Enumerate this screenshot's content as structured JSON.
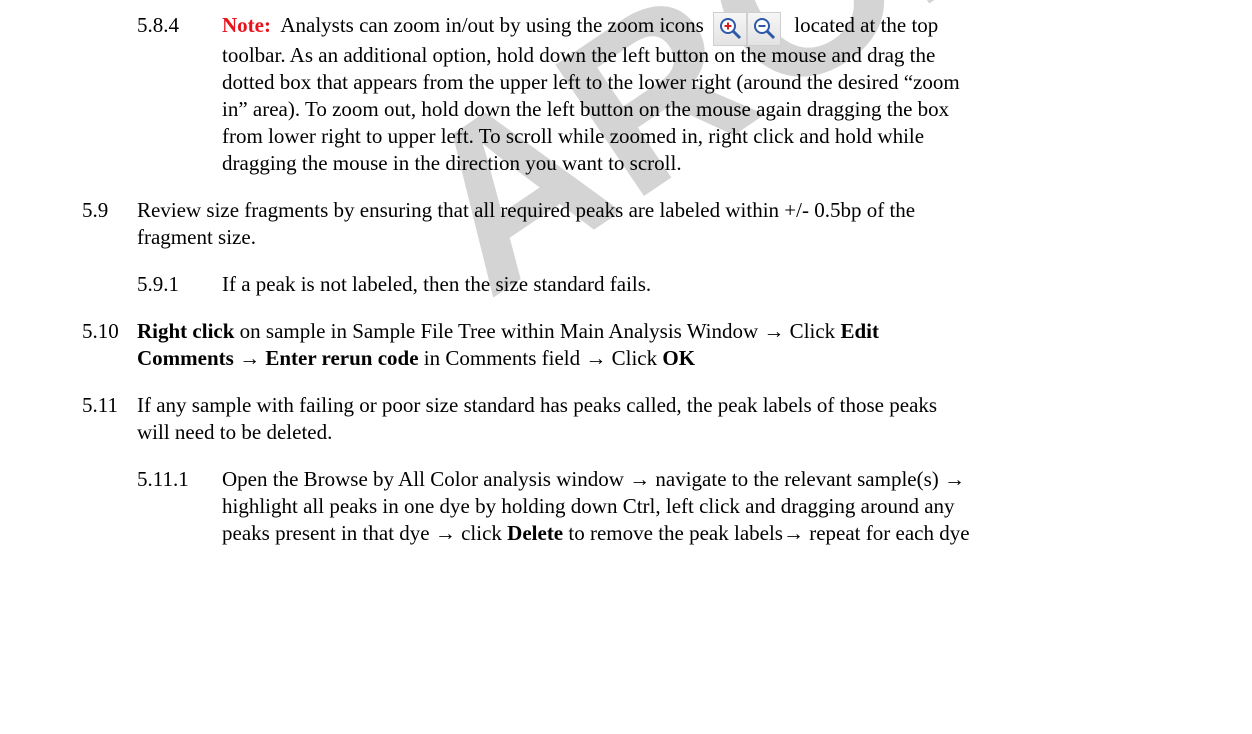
{
  "watermark": "ARCHIVED",
  "s584": {
    "number": "5.8.4",
    "note_label": "Note:",
    "text_before_icons": "Analysts can zoom in/out by using the zoom icons",
    "text_after_icons": "located at the top",
    "lines": [
      "toolbar.  As an additional option, hold down the left button on the mouse and drag the",
      "dotted box that appears from the upper left to the lower right (around the desired “zoom",
      "in” area). To zoom out, hold down the left button on the mouse again dragging the box",
      "from lower right to upper left. To scroll while zoomed in, right click and hold while",
      "dragging the mouse in the direction you want to scroll."
    ]
  },
  "s59": {
    "number": "5.9",
    "lines": [
      "Review size fragments by ensuring that all required peaks are labeled within +/- 0.5bp of the",
      "fragment size."
    ]
  },
  "s591": {
    "number": "5.9.1",
    "text": "If a peak is not labeled, then the size standard fails."
  },
  "s510": {
    "number": "5.10",
    "right_click": "Right click",
    "t1": " on sample in Sample File Tree within Main Analysis Window → Click ",
    "edit": "Edit",
    "comments": "Comments",
    "arrow": " → ",
    "enter_rerun": "Enter rerun code",
    "t2": " in Comments field → Click ",
    "ok": "OK"
  },
  "s511": {
    "number": "5.11",
    "lines": [
      "If any sample with failing or poor size standard has peaks called, the peak labels of those peaks",
      "will need to be deleted."
    ]
  },
  "s5111": {
    "number": "5.11.1",
    "line1": "Open the Browse by All Color analysis window → navigate to the relevant sample(s) →",
    "line2": "highlight all peaks in one dye by holding down Ctrl, left click and dragging around any",
    "line3a": "peaks present in that dye → click ",
    "delete": "Delete",
    "line3b": " to remove the peak labels→ repeat for each dye"
  }
}
